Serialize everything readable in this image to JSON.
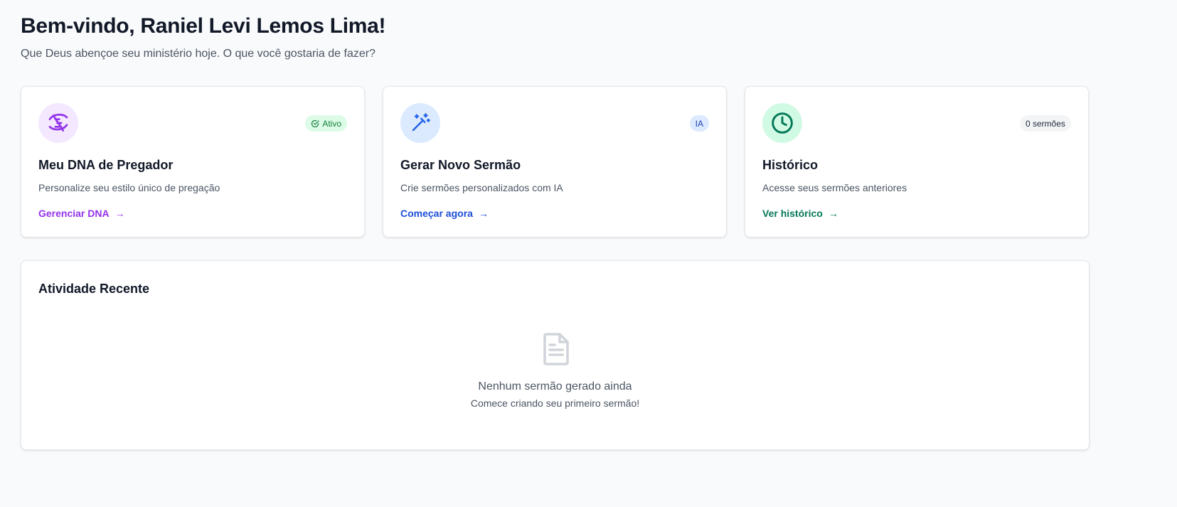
{
  "header": {
    "title": "Bem-vindo, Raniel Levi Lemos Lima!",
    "subtitle": "Que Deus abençoe seu ministério hoje. O que você gostaria de fazer?"
  },
  "cards": [
    {
      "icon": "dna-icon",
      "badge": "Ativo",
      "badge_icon": "check-circle-icon",
      "title": "Meu DNA de Pregador",
      "description": "Personalize seu estilo único de pregação",
      "link": "Gerenciar DNA",
      "arrow": "→",
      "accent": "#9333ea",
      "icon_bg": "#f3e8ff",
      "badge_bg": "#dcfce7",
      "badge_color": "#15803d"
    },
    {
      "icon": "magic-wand-icon",
      "badge": "IA",
      "title": "Gerar Novo Sermão",
      "description": "Crie sermões personalizados com IA",
      "link": "Começar agora",
      "arrow": "→",
      "accent": "#1d4ed8",
      "icon_bg": "#dbeafe",
      "badge_bg": "#dbeafe",
      "badge_color": "#1e40af"
    },
    {
      "icon": "clock-icon",
      "badge": "0 sermões",
      "title": "Histórico",
      "description": "Acesse seus sermões anteriores",
      "link": "Ver histórico",
      "arrow": "→",
      "accent": "#047857",
      "icon_bg": "#d1fae5",
      "badge_bg": "#f3f4f6",
      "badge_color": "#1f2937"
    }
  ],
  "activity": {
    "title": "Atividade Recente",
    "empty_icon": "document-icon",
    "empty_title": "Nenhum sermão gerado ainda",
    "empty_subtitle": "Comece criando seu primeiro sermão!"
  }
}
